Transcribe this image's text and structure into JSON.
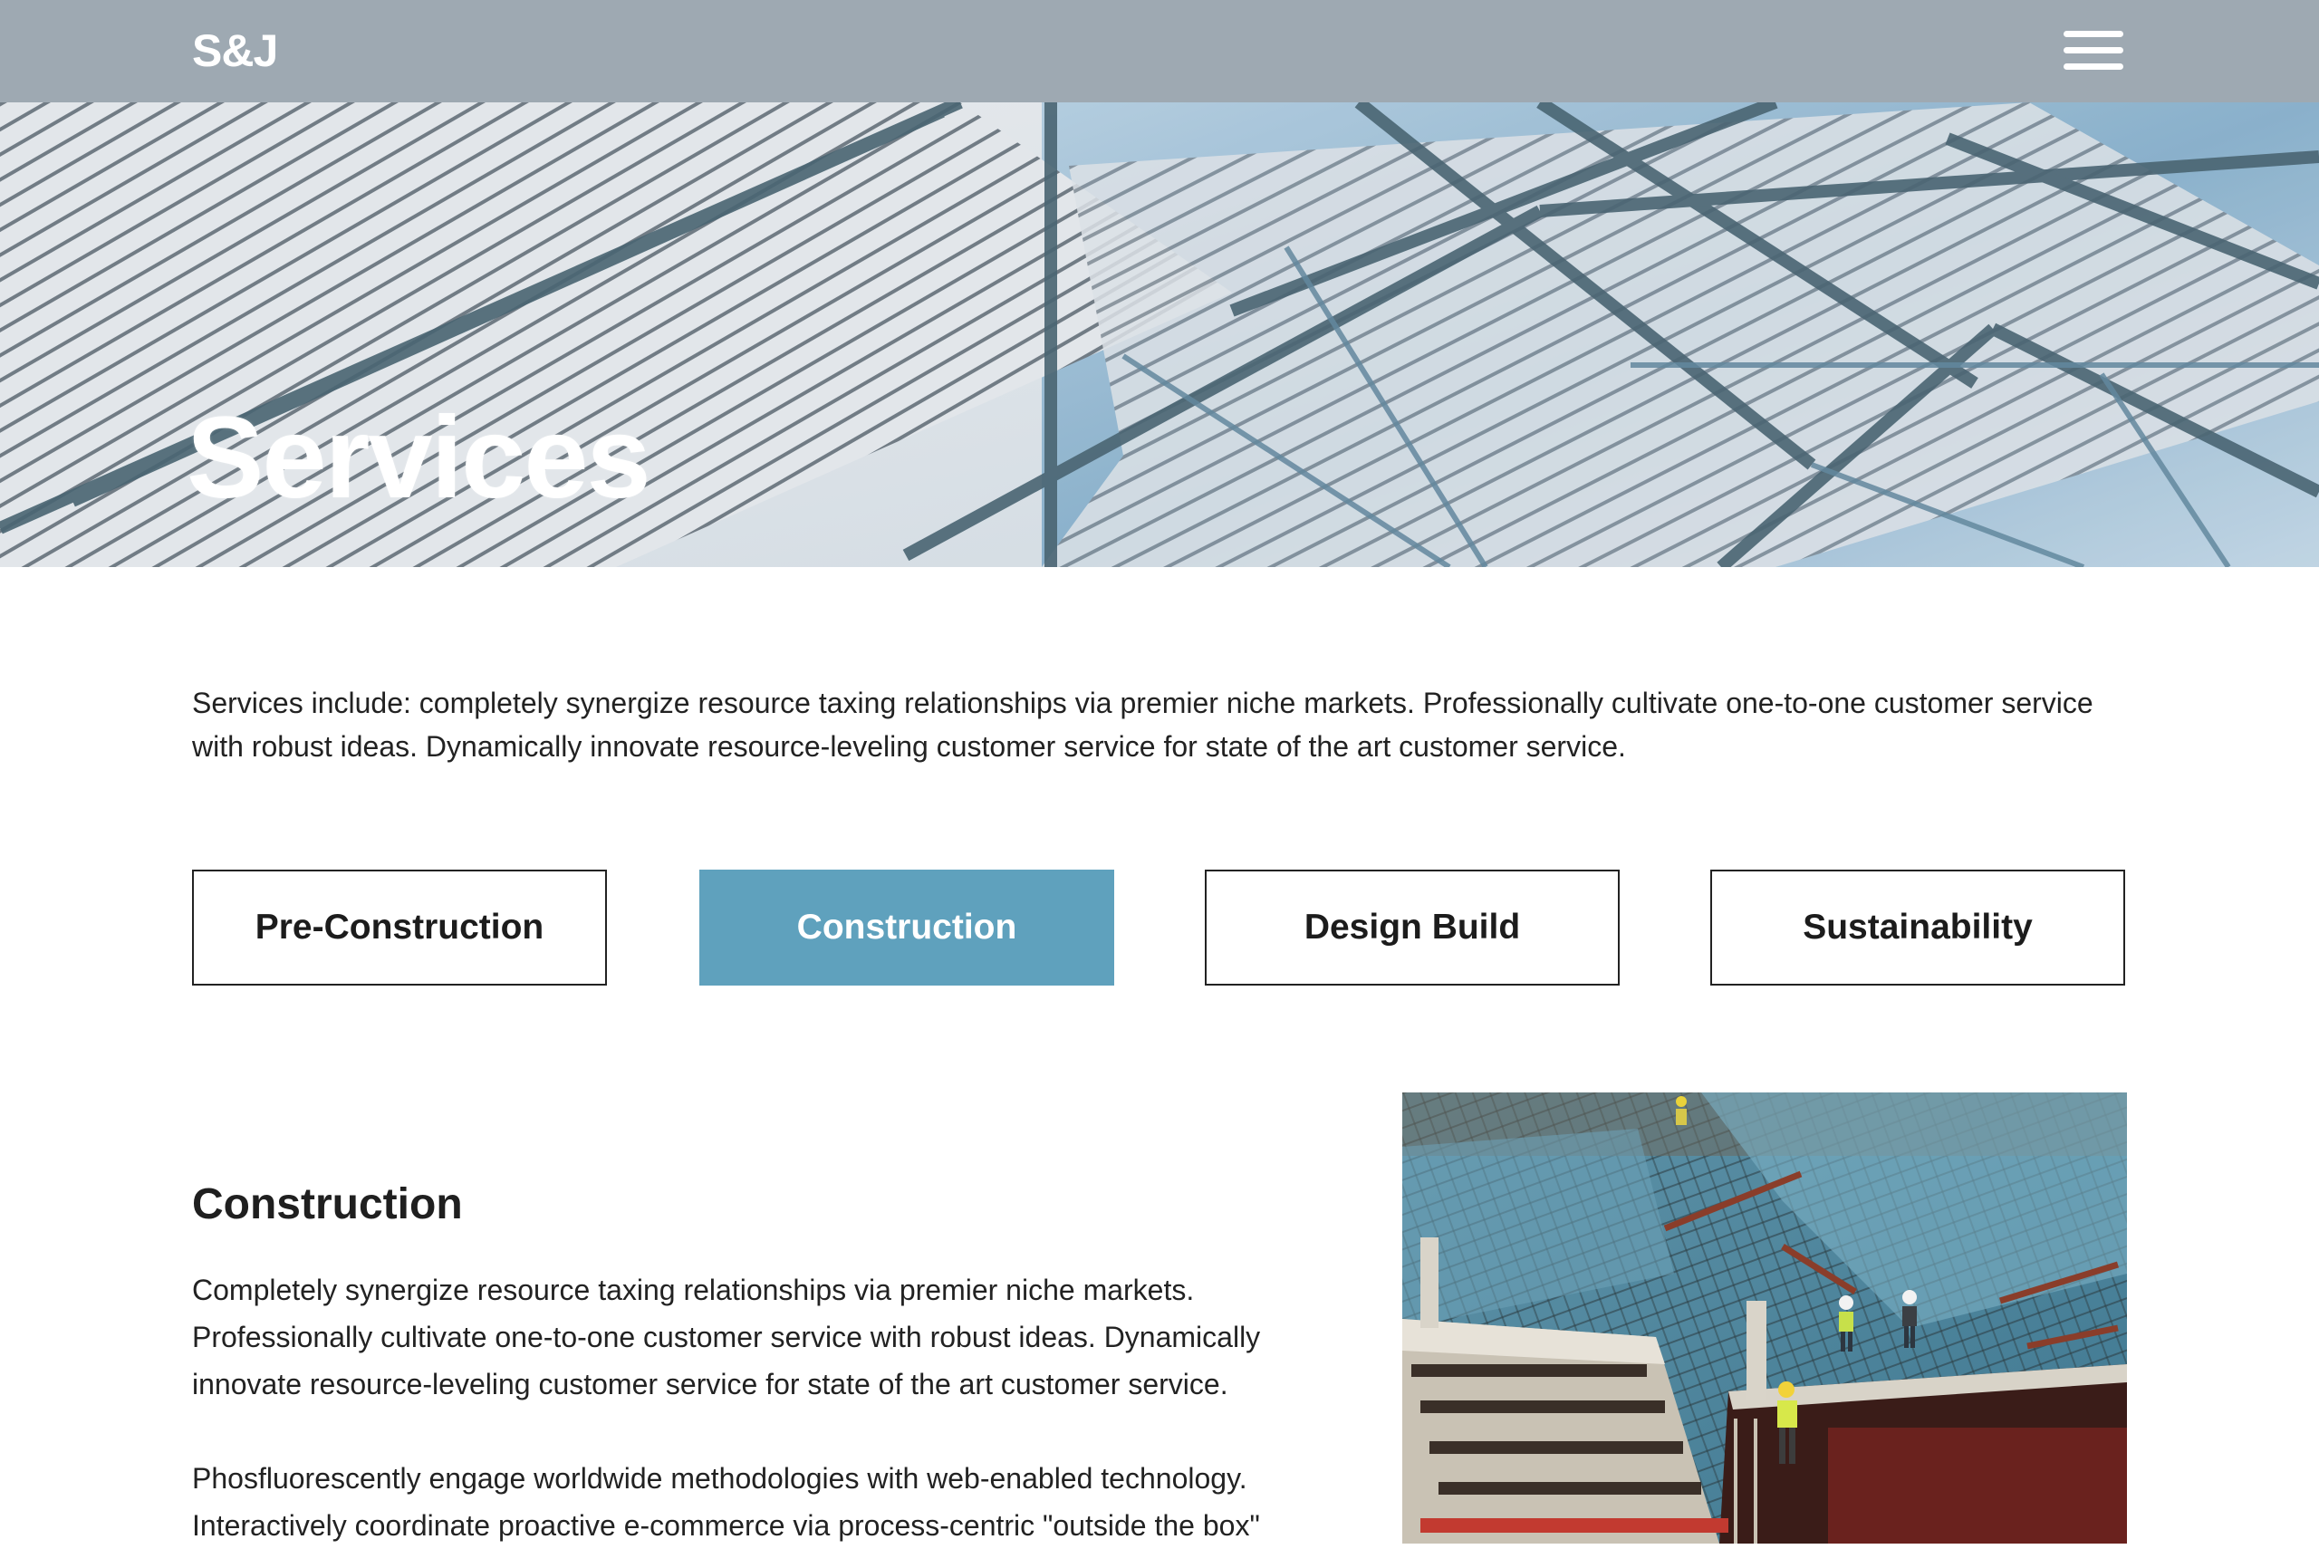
{
  "header": {
    "logo": "S&J",
    "menu_icon": "hamburger-menu-icon"
  },
  "hero": {
    "title": "Services",
    "image": "glass-and-steel-roof-architecture"
  },
  "intro": {
    "text": "Services include: completely synergize resource taxing relationships via premier niche markets. Professionally cultivate one-to-one customer service with robust ideas. Dynamically innovate resource-leveling customer service for state of the art customer service."
  },
  "tabs": [
    {
      "label": "Pre-Construction",
      "active": false
    },
    {
      "label": "Construction",
      "active": true
    },
    {
      "label": "Design Build",
      "active": false
    },
    {
      "label": "Sustainability",
      "active": false
    }
  ],
  "detail": {
    "title": "Construction",
    "paragraph1": "Completely synergize resource taxing relationships via premier niche markets. Professionally cultivate one-to-one customer service with robust ideas. Dynamically innovate resource-leveling customer service for state of the art customer service.",
    "paragraph2": "Phosfluorescently engage worldwide methodologies with web-enabled technology. Interactively coordinate proactive e-commerce via process-centric \"outside the box\"",
    "image": "construction-site-workers-photo"
  },
  "colors": {
    "header_bg": "#9ea9b2",
    "accent": "#5fa1bd",
    "text": "#222222"
  }
}
